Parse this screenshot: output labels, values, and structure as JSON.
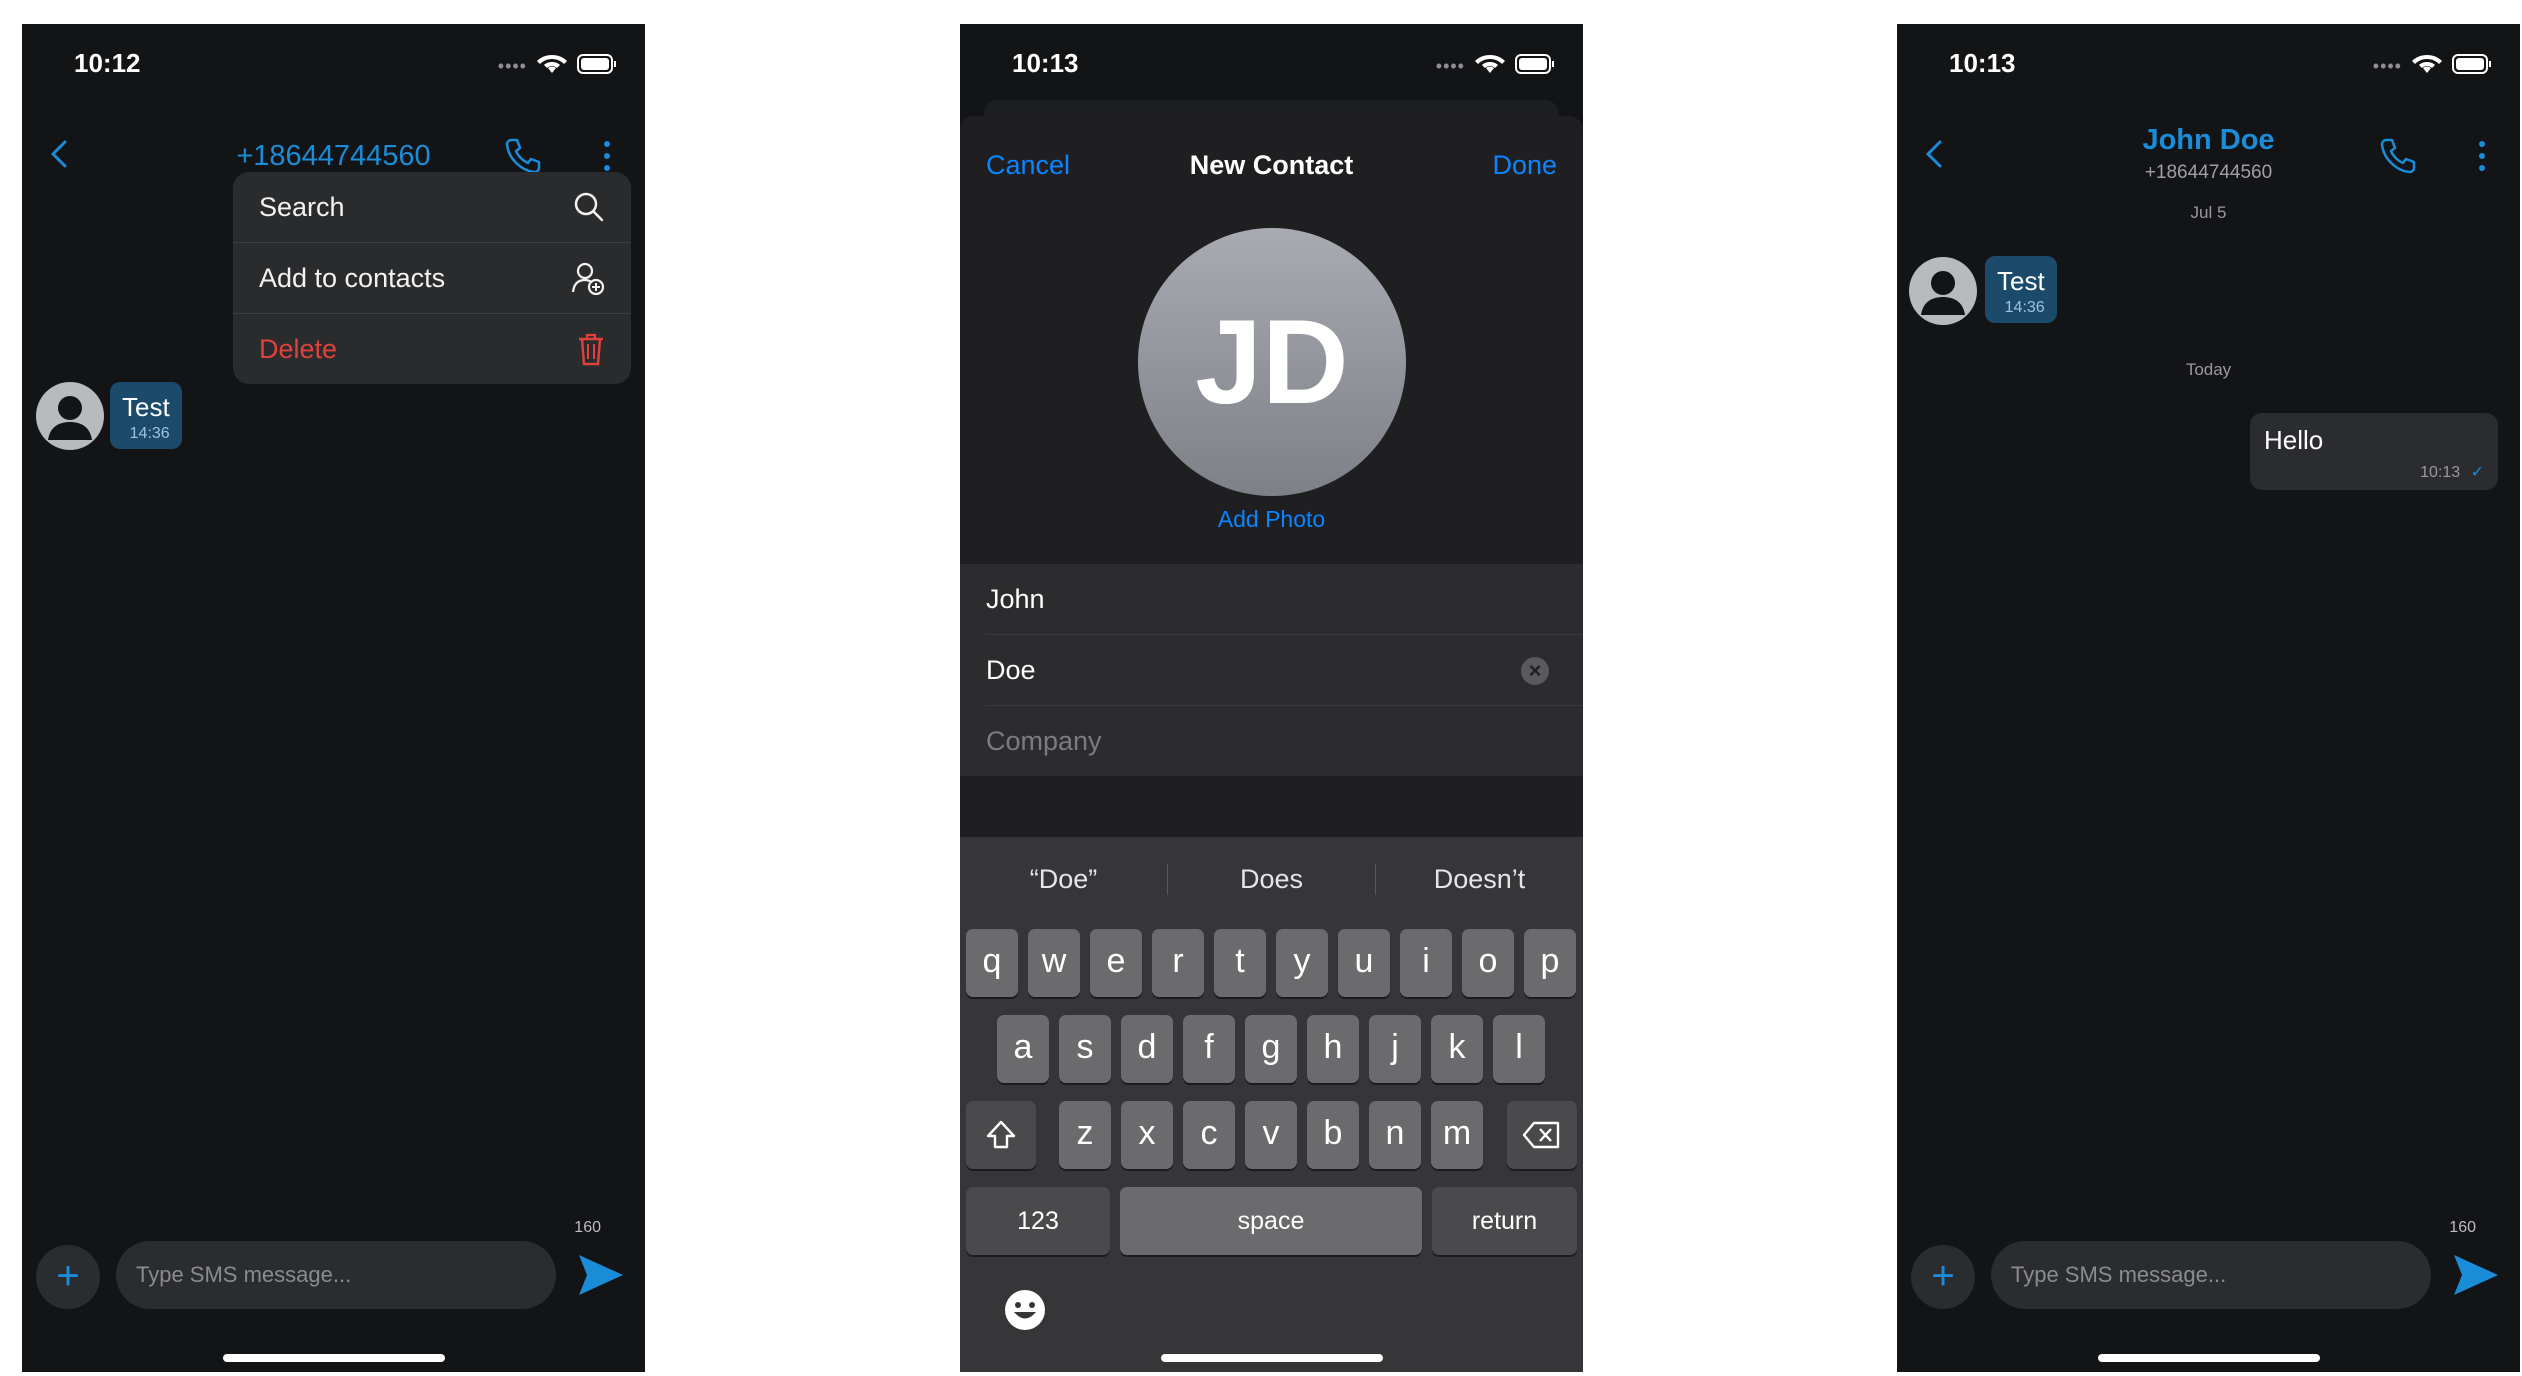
{
  "colors": {
    "accent": "#1a8cd8",
    "ios_blue": "#0a84ff",
    "danger": "#e0413c",
    "background": "#131416"
  },
  "screen1": {
    "time": "10:12",
    "header_title": "+18644744560",
    "menu": [
      {
        "label": "Search",
        "icon": "search-icon"
      },
      {
        "label": "Add to contacts",
        "icon": "add-person-icon"
      },
      {
        "label": "Delete",
        "icon": "trash-icon"
      }
    ],
    "message": {
      "text": "Test",
      "time": "14:36"
    },
    "composer": {
      "placeholder": "Type SMS message...",
      "counter": "160"
    }
  },
  "screen2": {
    "time": "10:13",
    "nav": {
      "cancel": "Cancel",
      "title": "New Contact",
      "done": "Done"
    },
    "initials": "JD",
    "add_photo": "Add Photo",
    "fields": {
      "first": "John",
      "last": "Doe",
      "company_placeholder": "Company"
    },
    "suggestions": [
      "“Doe”",
      "Does",
      "Doesn’t"
    ],
    "keys": {
      "row1": [
        "q",
        "w",
        "e",
        "r",
        "t",
        "y",
        "u",
        "i",
        "o",
        "p"
      ],
      "row2": [
        "a",
        "s",
        "d",
        "f",
        "g",
        "h",
        "j",
        "k",
        "l"
      ],
      "row3": [
        "z",
        "x",
        "c",
        "v",
        "b",
        "n",
        "m"
      ],
      "numbers": "123",
      "space": "space",
      "return": "return"
    }
  },
  "screen3": {
    "time": "10:13",
    "contact_name": "John Doe",
    "contact_number": "+18644744560",
    "date1": "Jul 5",
    "date2": "Today",
    "incoming": {
      "text": "Test",
      "time": "14:36"
    },
    "outgoing": {
      "text": "Hello",
      "time": "10:13"
    },
    "composer": {
      "placeholder": "Type SMS message...",
      "counter": "160"
    }
  }
}
